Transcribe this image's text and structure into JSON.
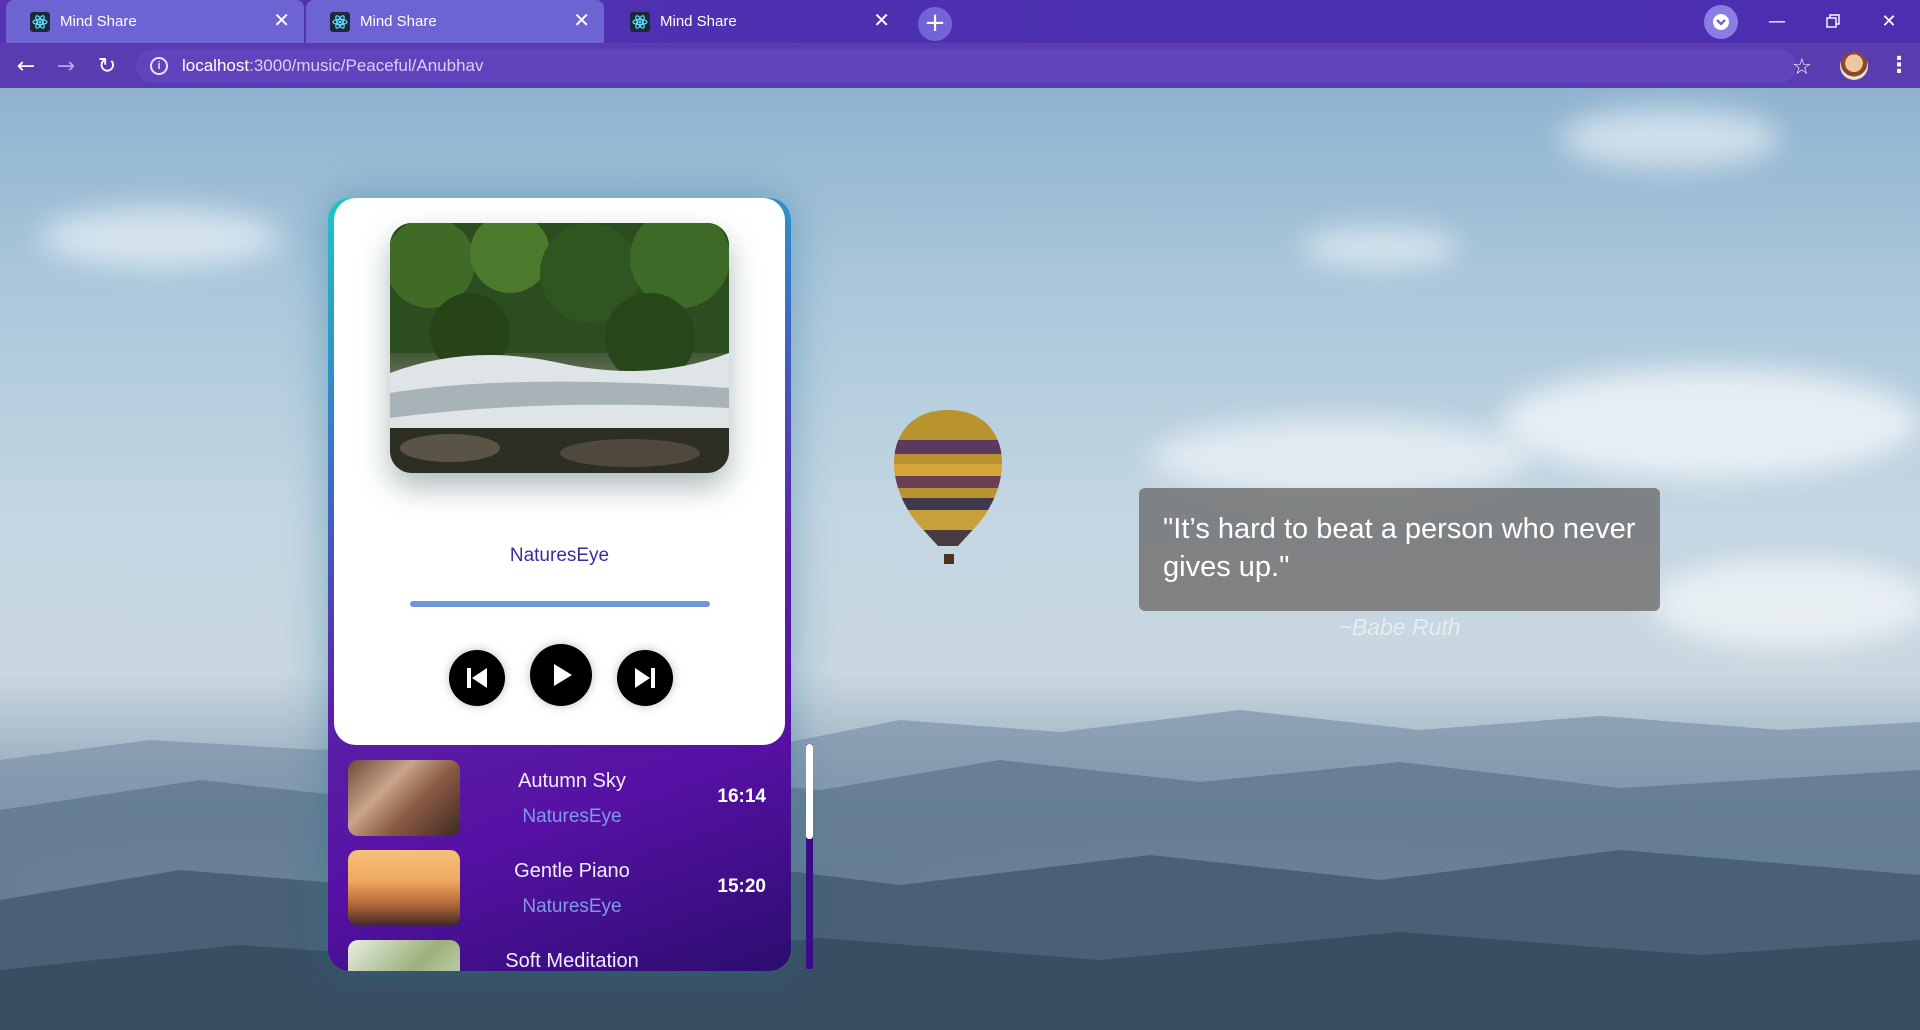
{
  "browser": {
    "tabs": [
      {
        "title": "Mind Share",
        "state": "inactive"
      },
      {
        "title": "Mind Share",
        "state": "inactive"
      },
      {
        "title": "Mind Share",
        "state": "active"
      }
    ],
    "url_host": "localhost",
    "url_path": ":3000/music/Peaceful/Anubhav",
    "icons": {
      "back": "back-arrow-icon",
      "forward": "forward-arrow-icon",
      "reload": "reload-icon",
      "info": "info-icon",
      "bookmark": "star-icon",
      "menu": "kebab-menu-icon",
      "new_tab": "plus-icon",
      "favicon": "react-atom-icon"
    }
  },
  "player": {
    "now_playing_artist": "NaturesEye",
    "progress_fraction": 0.0,
    "controls": {
      "previous": "skip-back-icon",
      "play": "play-icon",
      "next": "skip-forward-icon"
    }
  },
  "playlist": [
    {
      "title": "Autumn Sky",
      "artist": "NaturesEye",
      "duration": "16:14"
    },
    {
      "title": "Gentle Piano",
      "artist": "NaturesEye",
      "duration": "15:20"
    },
    {
      "title": "Soft Meditation",
      "artist": "",
      "duration": ""
    }
  ],
  "quote": {
    "text": "\"It’s hard to beat a person who never gives up.\"",
    "author": "~Babe Ruth"
  },
  "colors": {
    "chrome": "#5a3bb0",
    "card_gradient_start": "#1dc6c8",
    "card_gradient_mid": "#5b1fa8",
    "card_gradient_end": "#2c0d6f",
    "title_text": "#3e2b9c",
    "artist_text": "#7f9be8",
    "progress": "#6f97d5"
  }
}
